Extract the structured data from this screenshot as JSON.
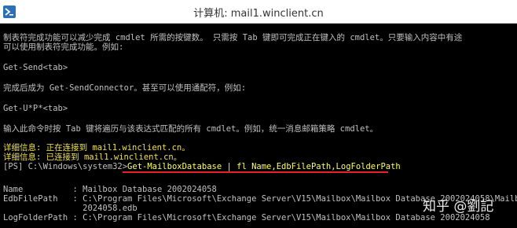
{
  "window": {
    "title": "计算机: mail1.winclient.cn",
    "icon": "powershell-icon"
  },
  "console": {
    "help_line_1": "制表符完成功能可以减少完成 cmdlet 所需的按键数。 只需按 Tab 键即可完成正在键入的 cmdlet。只要输入内容中有途",
    "help_line_2": "可以使用制表符完成功能。例如:",
    "example_1": "Get-Send<tab>",
    "help_line_3": "完成后成为 Get-SendConnector。甚至可以使用通配符，例如:",
    "example_2": "Get-U*P*<tab>",
    "help_line_4": "输入此命令时按 Tab 键将遍历与该表达式匹配的所有 cmdlet。例如，统一消息邮箱策略 cmdlet。",
    "verbose_1": "详细信息: 正在连接到 mail1.winclient.cn。",
    "verbose_2": "详细信息: 已连接到 mail1.winclient.cn。",
    "prompt": "[PS] C:\\Windows\\system32>",
    "command": "Get-MailboxDatabase | fl Name,EdbFilePath,LogFolderPath",
    "out_name": "Name          : Mailbox Database 2002024058",
    "out_edb_1": "EdbFilePath   : C:\\Program Files\\Microsoft\\Exchange Server\\V15\\Mailbox\\Mailbox Database 2002024058\\Mailbox",
    "out_edb_2": "                2024058.edb",
    "out_log": "LogFolderPath : C:\\Program Files\\Microsoft\\Exchange Server\\V15\\Mailbox\\Mailbox Database 2002024058"
  },
  "watermark": {
    "text": "知乎 @劉記"
  },
  "colors": {
    "background": "#000000",
    "text": "#c0c0c0",
    "verbose": "#f0e04a",
    "underline": "#e8202a"
  }
}
